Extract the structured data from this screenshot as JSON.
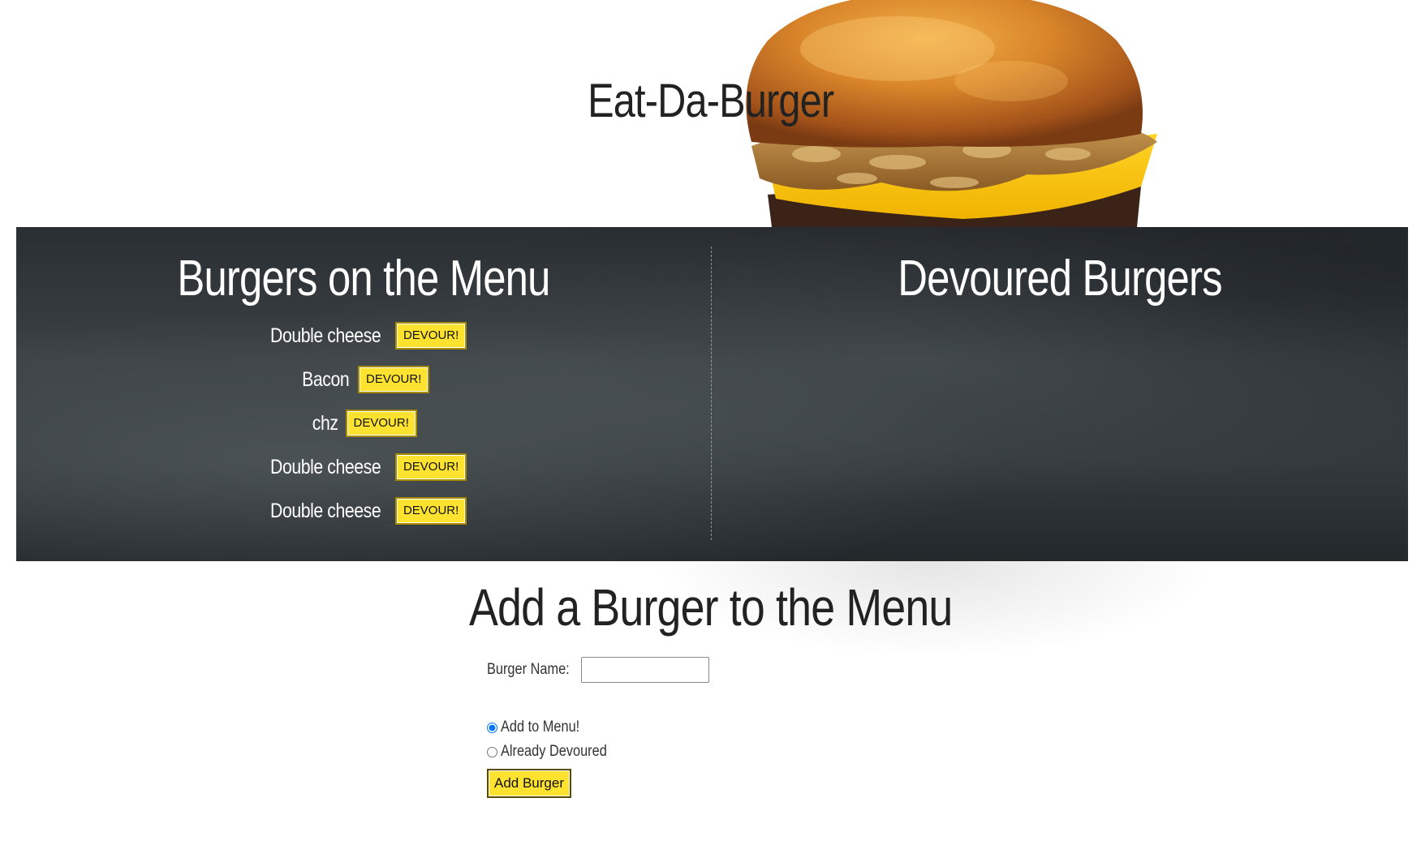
{
  "header": {
    "title": "Eat-Da-Burger"
  },
  "menu": {
    "title": "Burgers on the Menu",
    "devour_label": "DEVOUR!",
    "items": [
      {
        "name": "Double cheese"
      },
      {
        "name": "Bacon"
      },
      {
        "name": "chz"
      },
      {
        "name": "Double cheese"
      },
      {
        "name": "Double cheese"
      }
    ]
  },
  "devoured": {
    "title": "Devoured Burgers",
    "items": []
  },
  "form": {
    "title": "Add a Burger to the Menu",
    "name_label": "Burger Name:",
    "name_value": "",
    "options": [
      {
        "label": "Add to Menu!",
        "checked": true
      },
      {
        "label": "Already Devoured",
        "checked": false
      }
    ],
    "submit_label": "Add Burger"
  },
  "colors": {
    "button_yellow": "#fde22f",
    "chalkboard": "#33393d"
  }
}
